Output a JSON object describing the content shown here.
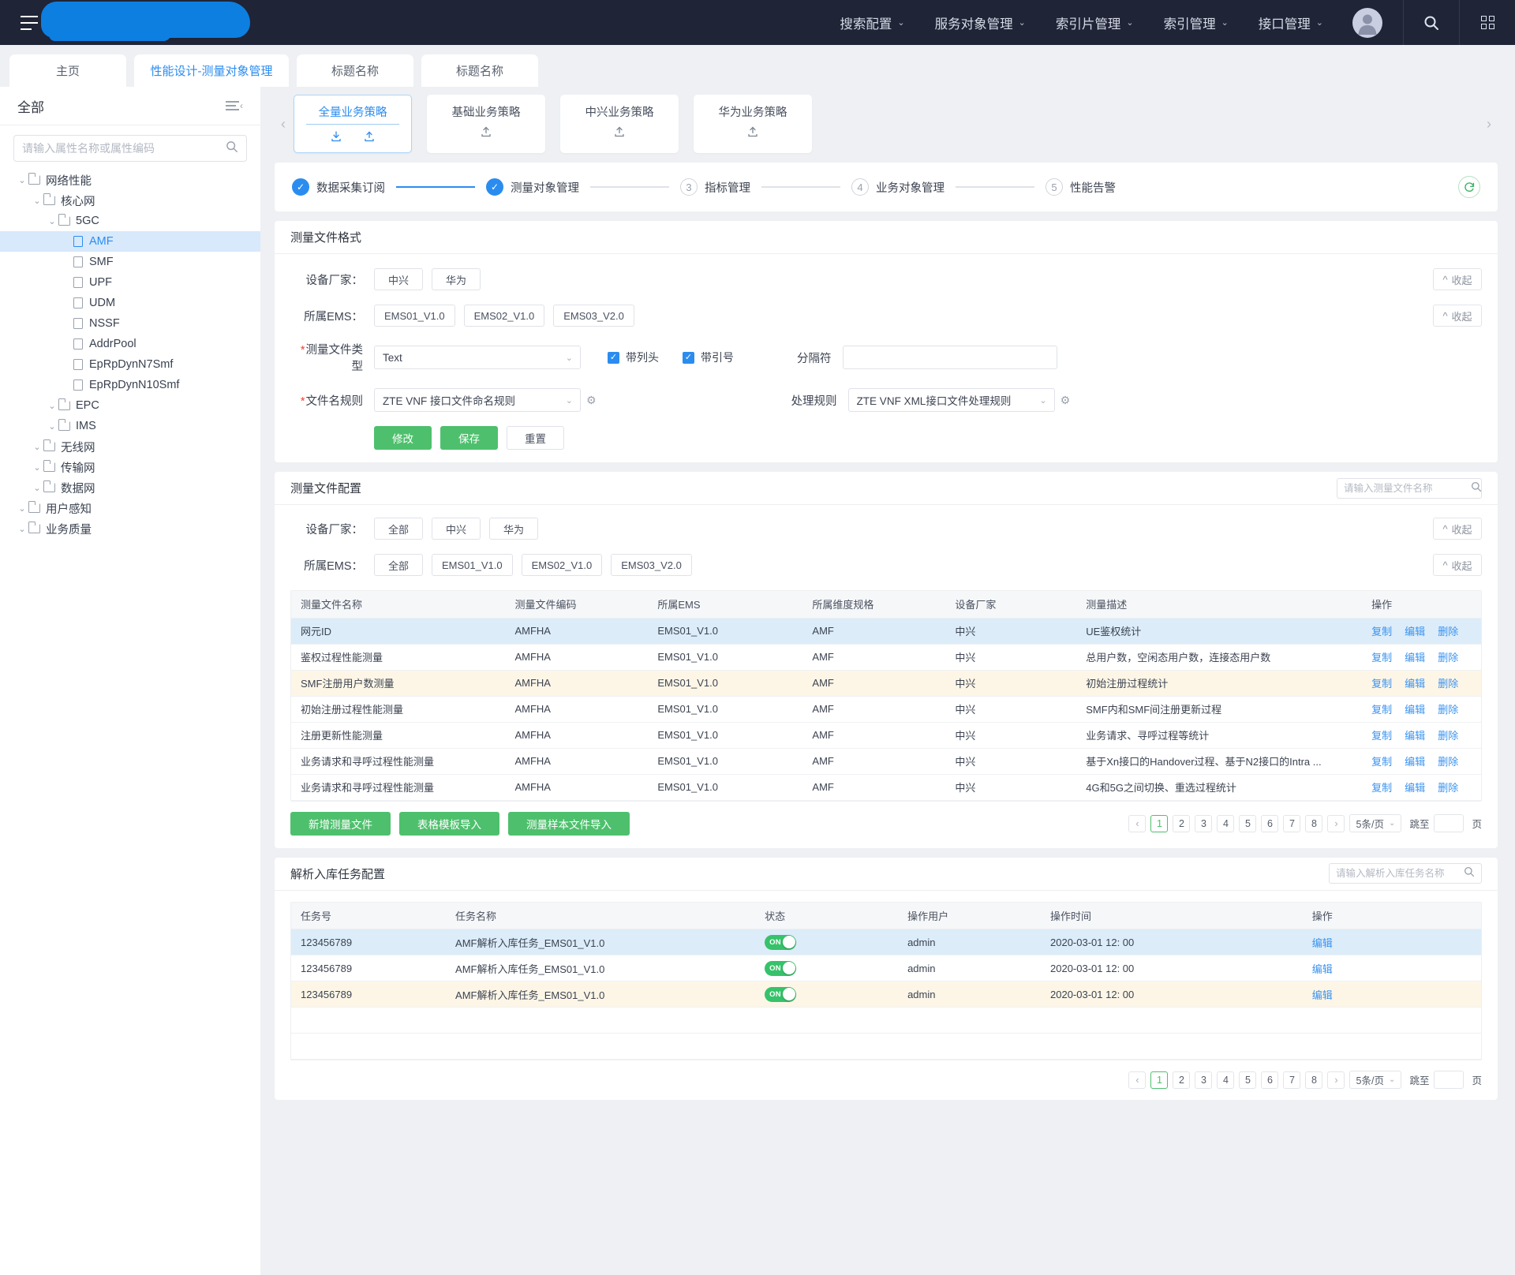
{
  "topnav": {
    "menu": [
      {
        "label": "搜索配置"
      },
      {
        "label": "服务对象管理"
      },
      {
        "label": "索引片管理"
      },
      {
        "label": "索引管理"
      },
      {
        "label": "接口管理"
      }
    ],
    "chevron": "⌄"
  },
  "tabs": [
    {
      "label": "主页",
      "active": false
    },
    {
      "label": "性能设计-测量对象管理",
      "active": true
    },
    {
      "label": "标题名称",
      "active": false
    },
    {
      "label": "标题名称",
      "active": false
    }
  ],
  "sidebar": {
    "title": "全部",
    "search_placeholder": "请输入属性名称或属性编码",
    "tree": [
      {
        "label": "网络性能",
        "depth": 0,
        "type": "folder",
        "expanded": true,
        "selected": false
      },
      {
        "label": "核心网",
        "depth": 1,
        "type": "folder",
        "expanded": true,
        "selected": false
      },
      {
        "label": "5GC",
        "depth": 2,
        "type": "folder",
        "expanded": true,
        "selected": false
      },
      {
        "label": "AMF",
        "depth": 3,
        "type": "file",
        "expanded": false,
        "selected": true
      },
      {
        "label": "SMF",
        "depth": 3,
        "type": "file",
        "expanded": false,
        "selected": false
      },
      {
        "label": "UPF",
        "depth": 3,
        "type": "file",
        "expanded": false,
        "selected": false
      },
      {
        "label": "UDM",
        "depth": 3,
        "type": "file",
        "expanded": false,
        "selected": false
      },
      {
        "label": "NSSF",
        "depth": 3,
        "type": "file",
        "expanded": false,
        "selected": false
      },
      {
        "label": "AddrPool",
        "depth": 3,
        "type": "file",
        "expanded": false,
        "selected": false
      },
      {
        "label": "EpRpDynN7Smf",
        "depth": 3,
        "type": "file",
        "expanded": false,
        "selected": false
      },
      {
        "label": "EpRpDynN10Smf",
        "depth": 3,
        "type": "file",
        "expanded": false,
        "selected": false
      },
      {
        "label": "EPC",
        "depth": 2,
        "type": "folder",
        "expanded": true,
        "selected": false
      },
      {
        "label": "IMS",
        "depth": 2,
        "type": "folder",
        "expanded": true,
        "selected": false
      },
      {
        "label": "无线网",
        "depth": 1,
        "type": "folder",
        "expanded": true,
        "selected": false
      },
      {
        "label": "传输网",
        "depth": 1,
        "type": "folder",
        "expanded": true,
        "selected": false
      },
      {
        "label": "数据网",
        "depth": 1,
        "type": "folder",
        "expanded": true,
        "selected": false
      },
      {
        "label": "用户感知",
        "depth": 0,
        "type": "folder",
        "expanded": true,
        "selected": false
      },
      {
        "label": "业务质量",
        "depth": 0,
        "type": "folder",
        "expanded": true,
        "selected": false
      }
    ]
  },
  "policy_cards": [
    {
      "label": "全量业务策略",
      "active": true,
      "icons": [
        "download-icon",
        "upload-icon"
      ]
    },
    {
      "label": "基础业务策略",
      "active": false,
      "icons": [
        "upload-icon"
      ]
    },
    {
      "label": "中兴业务策略",
      "active": false,
      "icons": [
        "upload-icon"
      ]
    },
    {
      "label": "华为业务策略",
      "active": false,
      "icons": [
        "upload-icon"
      ]
    }
  ],
  "steps": [
    {
      "num": "1",
      "label": "数据采集订阅",
      "done": true
    },
    {
      "num": "2",
      "label": "测量对象管理",
      "done": true
    },
    {
      "num": "3",
      "label": "指标管理",
      "done": false
    },
    {
      "num": "4",
      "label": "业务对象管理",
      "done": false
    },
    {
      "num": "5",
      "label": "性能告警",
      "done": false
    }
  ],
  "format_section": {
    "title": "测量文件格式",
    "vendor_label": "设备厂家：",
    "vendor_chips": [
      "中兴",
      "华为"
    ],
    "ems_label": "所属EMS：",
    "ems_chips": [
      "EMS01_V1.0",
      "EMS02_V1.0",
      "EMS03_V2.0"
    ],
    "collapse_label": "收起",
    "file_type_label": "测量文件类型",
    "file_type_value": "Text",
    "checkbox_header": "带列头",
    "checkbox_quote": "带引号",
    "separator_label": "分隔符",
    "separator_value": "",
    "filename_rule_label": "文件名规则",
    "filename_rule_value": "ZTE VNF 接口文件命名规则",
    "process_rule_label": "处理规则",
    "process_rule_value": "ZTE VNF XML接口文件处理规则",
    "buttons": {
      "modify": "修改",
      "save": "保存",
      "reset": "重置"
    }
  },
  "config_section": {
    "title": "测量文件配置",
    "search_placeholder": "请输入测量文件名称",
    "vendor_label": "设备厂家：",
    "vendor_chips": [
      "全部",
      "中兴",
      "华为"
    ],
    "ems_label": "所属EMS：",
    "ems_chips": [
      "全部",
      "EMS01_V1.0",
      "EMS02_V1.0",
      "EMS03_V2.0"
    ],
    "collapse_label": "收起",
    "columns": [
      "测量文件名称",
      "测量文件编码",
      "所属EMS",
      "所属维度规格",
      "设备厂家",
      "测量描述",
      "操作"
    ],
    "actions": [
      "复制",
      "编辑",
      "删除"
    ],
    "rows": [
      {
        "name": "网元ID",
        "code": "AMFHA",
        "ems": "EMS01_V1.0",
        "dim": "AMF",
        "vendor": "中兴",
        "desc": "UE鉴权统计",
        "tone": "blue"
      },
      {
        "name": "鉴权过程性能测量",
        "code": "AMFHA",
        "ems": "EMS01_V1.0",
        "dim": "AMF",
        "vendor": "中兴",
        "desc": "总用户数，空闲态用户数，连接态用户数",
        "tone": "white"
      },
      {
        "name": "SMF注册用户数测量",
        "code": "AMFHA",
        "ems": "EMS01_V1.0",
        "dim": "AMF",
        "vendor": "中兴",
        "desc": "初始注册过程统计",
        "tone": "cream"
      },
      {
        "name": "初始注册过程性能测量",
        "code": "AMFHA",
        "ems": "EMS01_V1.0",
        "dim": "AMF",
        "vendor": "中兴",
        "desc": "SMF内和SMF间注册更新过程",
        "tone": "white"
      },
      {
        "name": "注册更新性能测量",
        "code": "AMFHA",
        "ems": "EMS01_V1.0",
        "dim": "AMF",
        "vendor": "中兴",
        "desc": "业务请求、寻呼过程等统计",
        "tone": "white"
      },
      {
        "name": "业务请求和寻呼过程性能测量",
        "code": "AMFHA",
        "ems": "EMS01_V1.0",
        "dim": "AMF",
        "vendor": "中兴",
        "desc": "基于Xn接口的Handover过程、基于N2接口的Intra ...",
        "tone": "white"
      },
      {
        "name": "业务请求和寻呼过程性能测量",
        "code": "AMFHA",
        "ems": "EMS01_V1.0",
        "dim": "AMF",
        "vendor": "中兴",
        "desc": "4G和5G之间切换、重选过程统计",
        "tone": "white"
      }
    ],
    "footer_buttons": [
      "新增测量文件",
      "表格模板导入",
      "测量样本文件导入"
    ],
    "pagination": {
      "prev": "‹",
      "next": "›",
      "pages": [
        "1",
        "2",
        "3",
        "4",
        "5",
        "6",
        "7",
        "8"
      ],
      "current": "1",
      "page_size": "5条/页",
      "jump_label": "跳至",
      "jump_value": "",
      "page_unit": "页"
    }
  },
  "task_section": {
    "title": "解析入库任务配置",
    "search_placeholder": "请输入解析入库任务名称",
    "columns": [
      "任务号",
      "任务名称",
      "状态",
      "操作用户",
      "操作时间",
      "操作"
    ],
    "action": "编辑",
    "rows": [
      {
        "id": "123456789",
        "name": "AMF解析入库任务_EMS01_V1.0",
        "state": "ON",
        "user": "admin",
        "time": "2020-03-01 12: 00",
        "tone": "blue"
      },
      {
        "id": "123456789",
        "name": "AMF解析入库任务_EMS01_V1.0",
        "state": "ON",
        "user": "admin",
        "time": "2020-03-01 12: 00",
        "tone": "white"
      },
      {
        "id": "123456789",
        "name": "AMF解析入库任务_EMS01_V1.0",
        "state": "ON",
        "user": "admin",
        "time": "2020-03-01 12: 00",
        "tone": "cream"
      }
    ],
    "pagination": {
      "prev": "‹",
      "next": "›",
      "pages": [
        "1",
        "2",
        "3",
        "4",
        "5",
        "6",
        "7",
        "8"
      ],
      "current": "1",
      "page_size": "5条/页",
      "jump_label": "跳至",
      "jump_value": "",
      "page_unit": "页"
    }
  },
  "colors": {
    "nav_bg": "#1f2437",
    "accent_blue": "#2b8cf0",
    "accent_green": "#4ec06d",
    "row_blue": "#dcecf9",
    "row_cream": "#fdf6e7",
    "brand_blob": "#0d7fe0"
  }
}
